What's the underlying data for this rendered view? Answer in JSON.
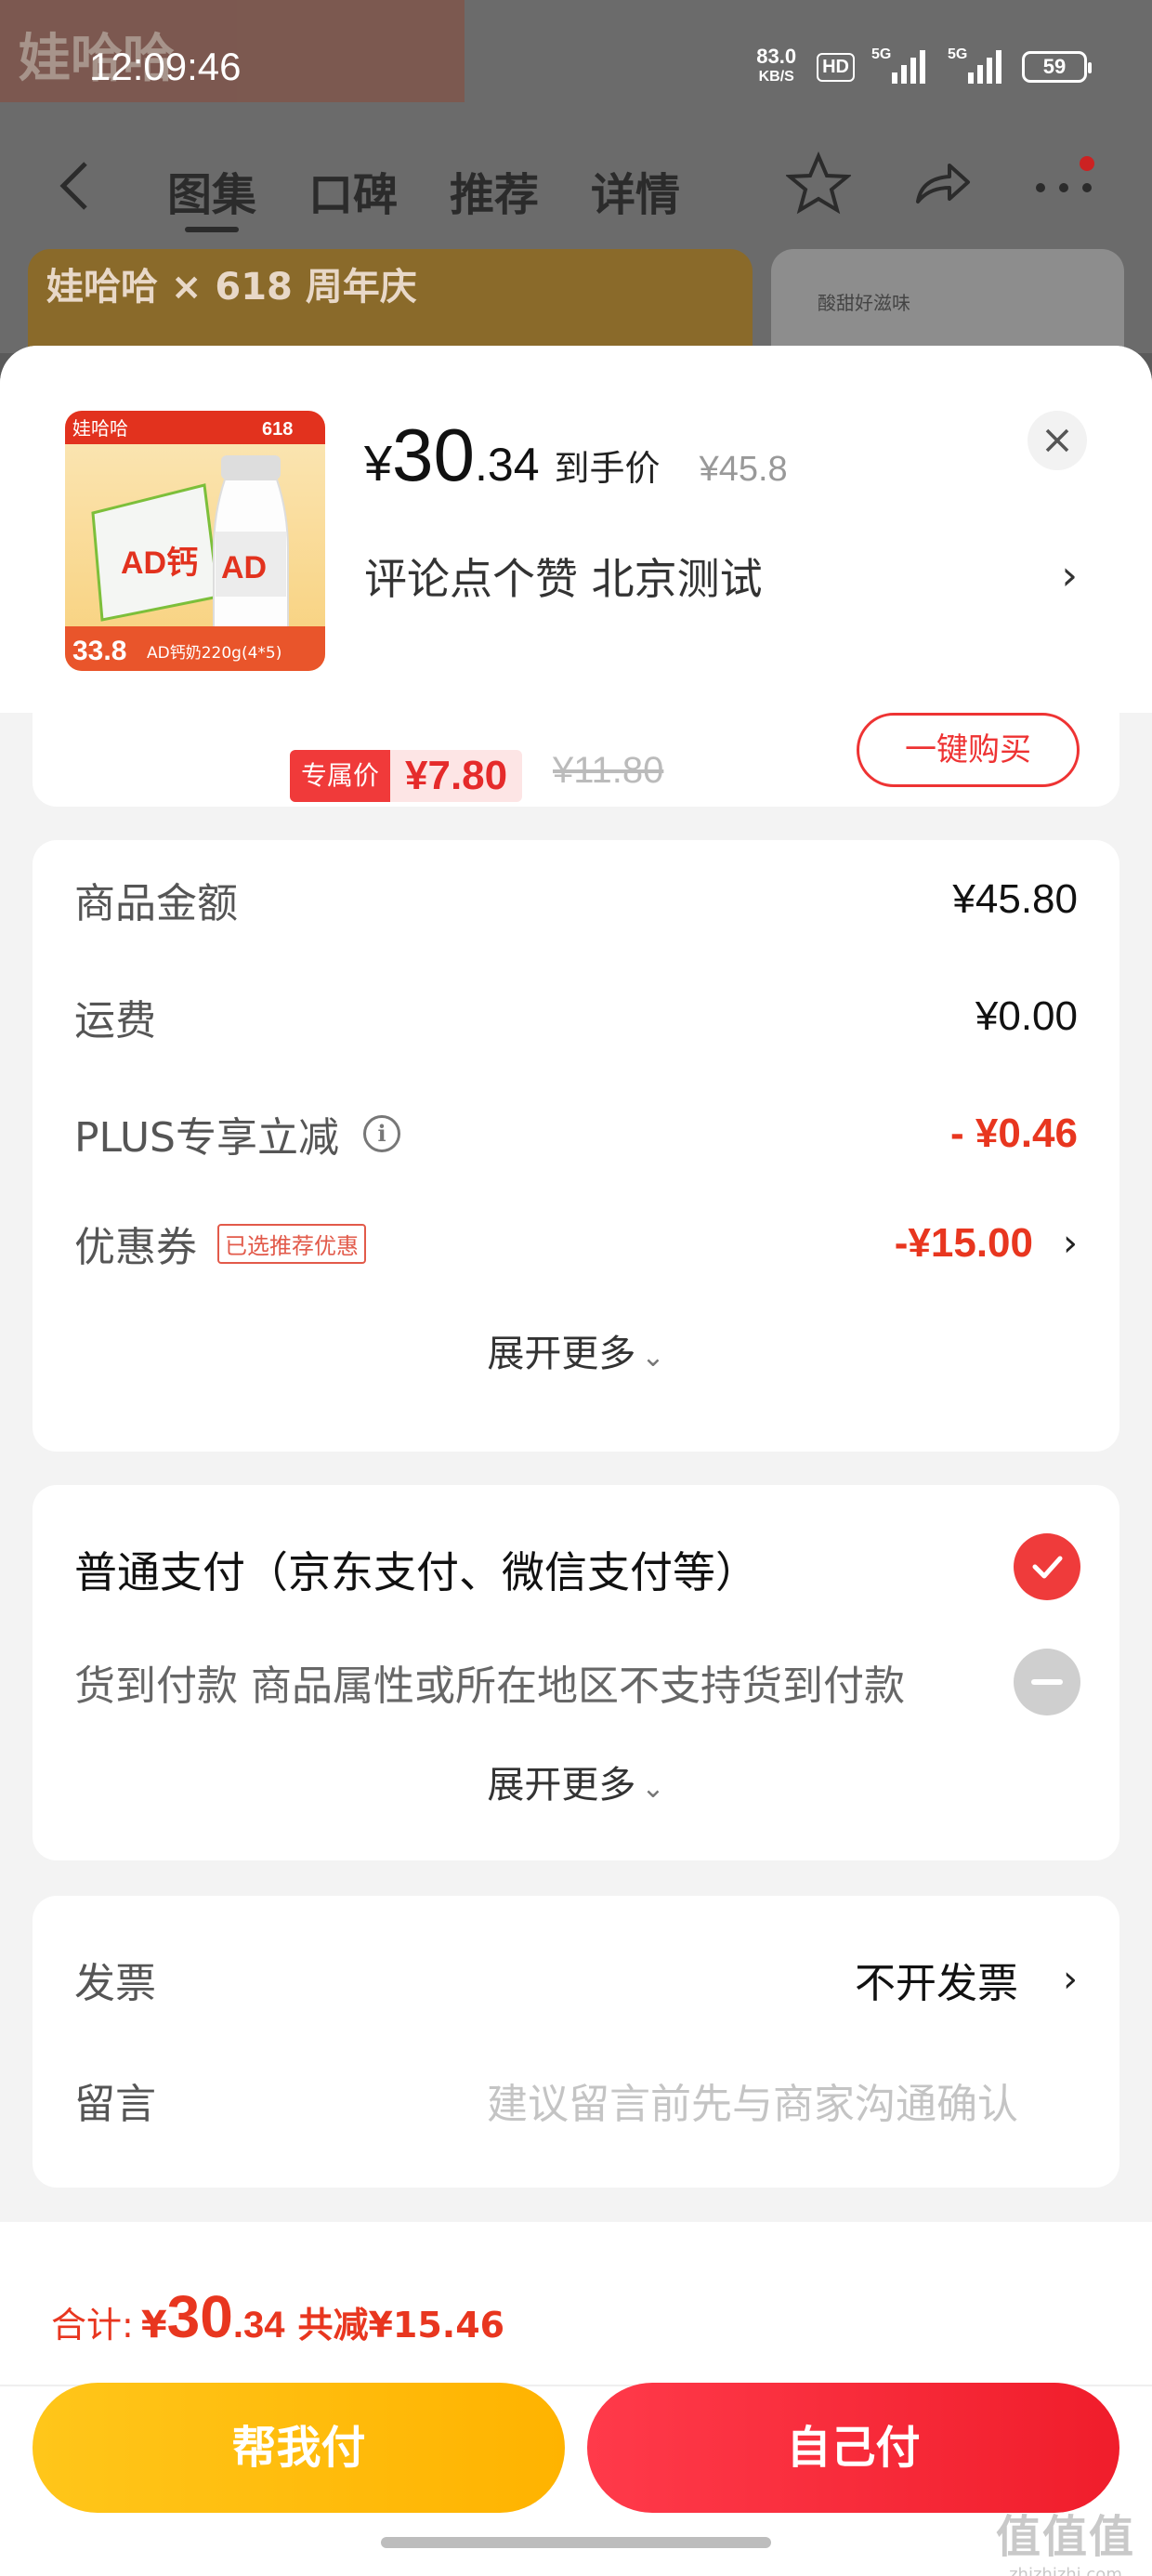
{
  "status_bar": {
    "time": "12:09:46",
    "net_speed": "83.0",
    "net_unit": "KB/S",
    "hd": "HD",
    "sig1": "5G",
    "sig2": "5G",
    "battery": "59"
  },
  "background_page": {
    "brand": "娃哈哈",
    "tabs": [
      "图集",
      "口碑",
      "推荐",
      "详情"
    ],
    "banner_text": "娃哈哈 × 618 周年庆",
    "thumb_text": "酸甜好滋味"
  },
  "product": {
    "price_yen": "¥",
    "price_int": "30",
    "price_dec": ".34",
    "price_tag": "到手价",
    "price_orig": "¥45.8",
    "subtitle": "评论点个赞  北京测试",
    "image_brand": "娃哈哈",
    "image_badge": "618",
    "image_caption": "AD钙奶220g(4*5)",
    "image_price": "33.8",
    "image_product": "AD钙"
  },
  "partial_card": {
    "exclusive_label": "专属价",
    "exclusive_price": "¥7.80",
    "exclusive_orig": "¥11.80",
    "one_click": "一键购买"
  },
  "amount": {
    "rows": [
      {
        "label": "商品金额",
        "value": "¥45.80"
      },
      {
        "label": "运费",
        "value": "¥0.00"
      },
      {
        "label": "PLUS专享立减",
        "value": "- ¥0.46"
      },
      {
        "label": "优惠券",
        "badge": "已选推荐优惠",
        "value": "-¥15.00"
      }
    ],
    "expand": "展开更多"
  },
  "payment": {
    "normal": "普通支付（京东支付、微信支付等）",
    "cod": "货到付款 商品属性或所在地区不支持货到付款",
    "expand": "展开更多"
  },
  "invoice": {
    "label": "发票",
    "value": "不开发票",
    "message_label": "留言",
    "message_placeholder": "建议留言前先与商家沟通确认"
  },
  "footer": {
    "total_label": "合计:",
    "total_yen": "¥",
    "total_int": "30",
    "total_dec": ".34",
    "total_save": "共减¥15.46",
    "help_pay": "帮我付",
    "self_pay": "自己付"
  },
  "watermark": {
    "big": "值值值",
    "small": "zhizhizhi.com"
  },
  "colors": {
    "accent_red": "#e8361f",
    "check_red": "#ef3b3b",
    "help_yellow": "#ffc61a"
  }
}
